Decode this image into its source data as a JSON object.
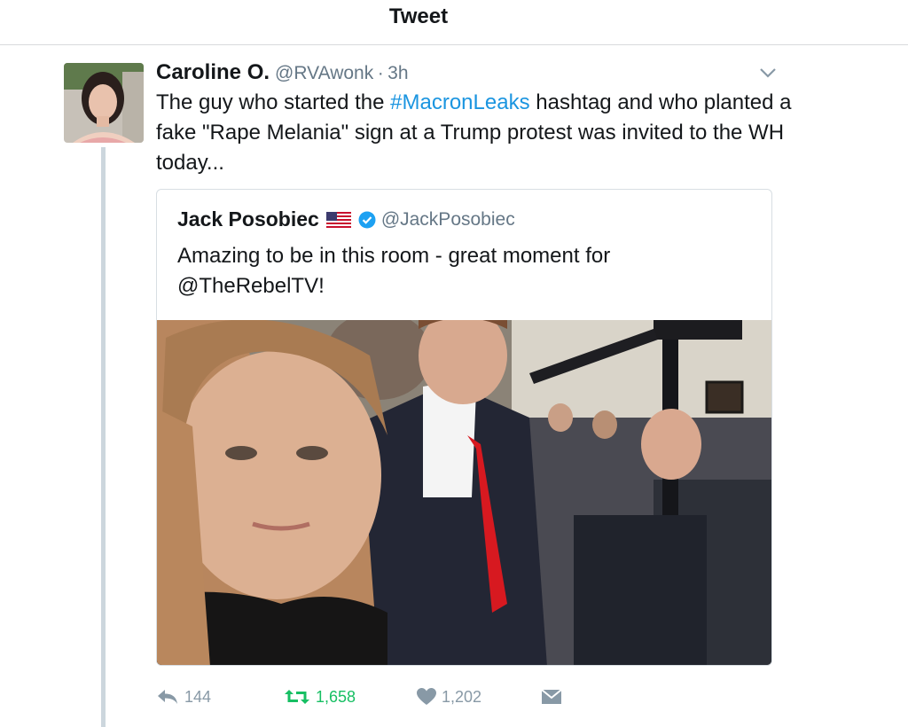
{
  "header": {
    "title": "Tweet"
  },
  "tweet": {
    "display_name": "Caroline O.",
    "handle": "@RVAwonk",
    "separator": "·",
    "timestamp": "3h",
    "text_before": "The guy who started the ",
    "hashtag": "#MacronLeaks",
    "text_after": " hashtag and who planted a fake \"Rape Melania\" sign at a Trump protest was invited to the WH today...",
    "quoted": {
      "display_name": "Jack Posobiec",
      "handle": "@JackPosobiec",
      "text": "Amazing to be in this room - great moment for @TheRebelTV!"
    },
    "actions": {
      "reply_count": "144",
      "retweet_count": "1,658",
      "like_count": "1,202"
    }
  },
  "colors": {
    "link": "#1b95e0",
    "retweet": "#17bf63",
    "muted": "#657786",
    "thread_line": "#ccd6dd"
  },
  "icons": [
    "chevron-down-icon",
    "us-flag-icon",
    "verified-badge-icon",
    "reply-icon",
    "retweet-icon",
    "heart-icon",
    "direct-message-icon"
  ]
}
